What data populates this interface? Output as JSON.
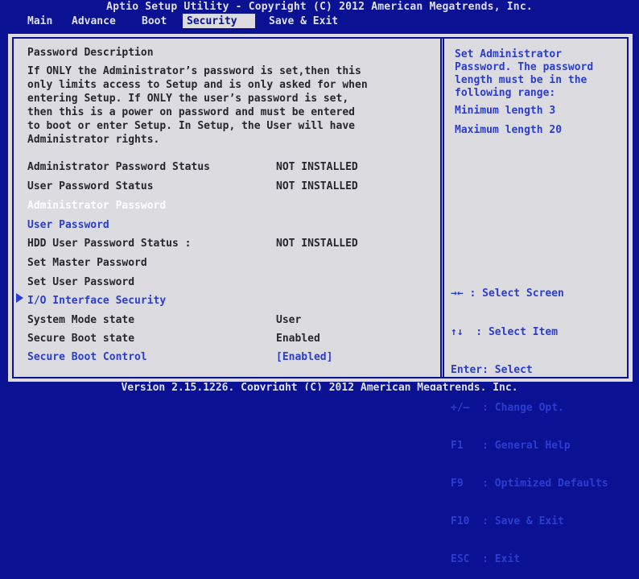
{
  "title": "Aptio Setup Utility - Copyright (C) 2012 American Megatrends, Inc.",
  "tabs": [
    {
      "label": "Main"
    },
    {
      "label": "Advance"
    },
    {
      "label": "Boot"
    },
    {
      "label": "Security",
      "active": true
    },
    {
      "label": "Save & Exit"
    }
  ],
  "main": {
    "heading": "Password Description",
    "description": "If ONLY the Administrator’s password is set,then this\nonly limits access to Setup and is only asked for when\nentering Setup. If ONLY the user’s password is set,\nthen this is a power on password and must be entered\nto boot or enter Setup. In Setup, the User will have\nAdministrator rights.",
    "items": [
      {
        "label": "Administrator Password Status",
        "value": "NOT INSTALLED"
      },
      {
        "label": "User Password Status",
        "value": "NOT INSTALLED"
      },
      {
        "label": "Administrator Password",
        "value": ""
      },
      {
        "label": "User Password",
        "value": ""
      },
      {
        "label": "HDD User Password Status :",
        "value": "NOT INSTALLED"
      },
      {
        "label": "Set Master Password",
        "value": ""
      },
      {
        "label": "Set User Password",
        "value": ""
      },
      {
        "label": "I/O Interface Security",
        "value": ""
      },
      {
        "label": "System Mode state",
        "value": "User"
      },
      {
        "label": "Secure Boot state",
        "value": "Enabled"
      },
      {
        "label": "Secure Boot Control",
        "value": "[Enabled]"
      }
    ]
  },
  "help": {
    "text": "Set Administrator\nPassword. The password\nlength must be in the\nfollowing range:",
    "min": "Minimum length 3",
    "max": "Maximum length 20"
  },
  "keys": [
    "→← : Select Screen",
    "↑↓  : Select Item",
    "Enter: Select",
    "+/—  : Change Opt.",
    "F1   : General Help",
    "F9   : Optimized Defaults",
    "F10  : Save & Exit",
    "ESC  : Exit"
  ],
  "footer": "Version 2.15.1226. Copyright (C) 2012 American Megatrends, Inc.",
  "colors": {
    "background": "#0a1192",
    "panel": "#dcdce0",
    "text": "#26262e",
    "highlight": "#2b3dd0",
    "selected": "#ffffff"
  }
}
